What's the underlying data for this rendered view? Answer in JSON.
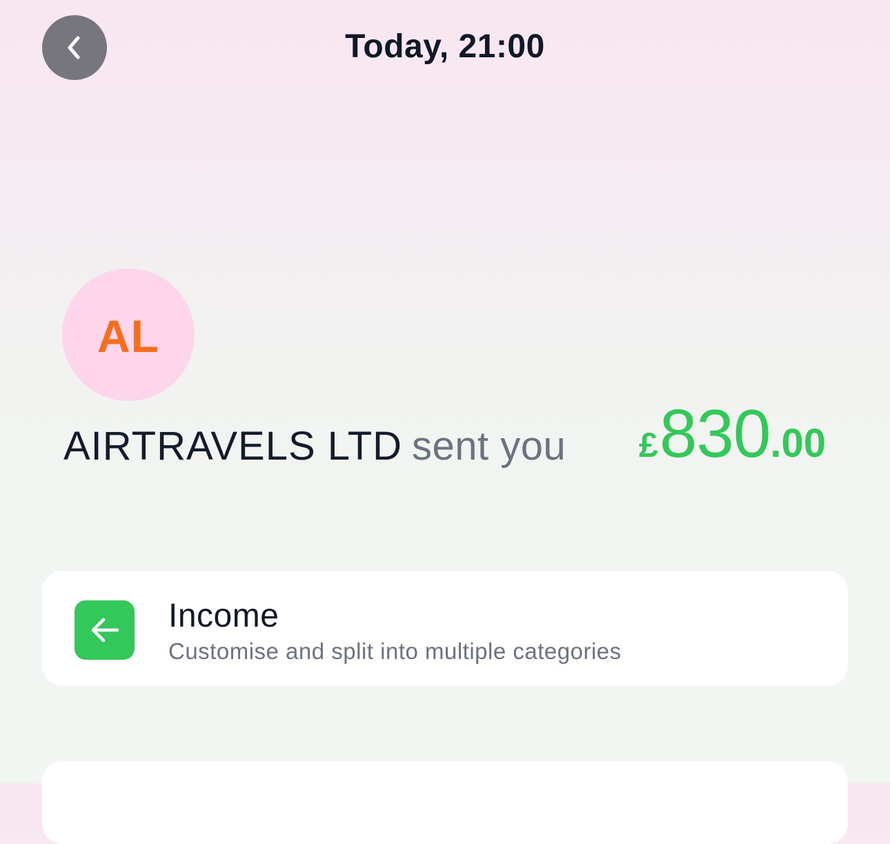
{
  "header": {
    "title": "Today, 21:00",
    "back_icon": "chevron-left-icon"
  },
  "transaction": {
    "avatar_initials": "AL",
    "merchant": "AIRTRAVELS LTD",
    "verb": "sent you",
    "amount": {
      "currency": "£",
      "major": "830",
      "minor": ".00"
    }
  },
  "category": {
    "icon": "arrow-left-icon",
    "title": "Income",
    "subtitle": "Customise and split into multiple categories"
  },
  "colors": {
    "amount": "#34c759",
    "avatar_bg": "#fdd6ec",
    "avatar_text": "#f46e1e",
    "category_icon_bg": "#34c759",
    "back_button_bg": "#77767e"
  }
}
